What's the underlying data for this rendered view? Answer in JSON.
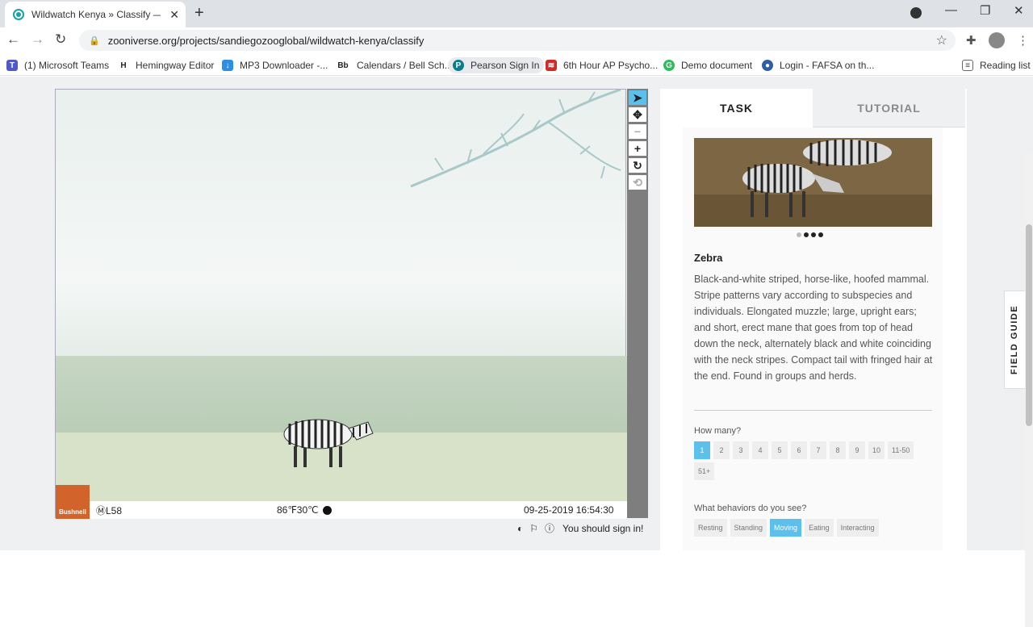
{
  "browser": {
    "tab_title": "Wildwatch Kenya » Classify — Zo",
    "url": "zooniverse.org/projects/sandiegozooglobal/wildwatch-kenya/classify",
    "bookmarks": [
      {
        "label": "(1) Microsoft Teams"
      },
      {
        "label": "Hemingway Editor"
      },
      {
        "label": "MP3 Downloader -..."
      },
      {
        "label": "Calendars / Bell Sch..."
      },
      {
        "label": "Pearson Sign In"
      },
      {
        "label": "6th Hour AP Psycho..."
      },
      {
        "label": "Demo document"
      },
      {
        "label": "Login - FAFSA on th..."
      }
    ],
    "reading_list": "Reading list",
    "icons": {
      "new_tab": "+",
      "close": "✕"
    }
  },
  "subject": {
    "camera_model": "ⓂL58",
    "temperature": "86℉30℃",
    "timestamp": "09-25-2019 16:54:30",
    "brand": "Bushnell"
  },
  "meta": {
    "sign_in": "You should sign in!"
  },
  "panel": {
    "tabs": [
      {
        "label": "TASK",
        "active": true
      },
      {
        "label": "TUTORIAL",
        "active": false
      }
    ],
    "species": {
      "name": "Zebra",
      "description": "Black-and-white striped, horse-like, hoofed mammal. Stripe patterns vary according to subspecies and individuals. Elongated muzzle; large, upright ears; and short, erect mane that goes from top of head down the neck, alternately black and white coinciding with the neck stripes. Compact tail with fringed hair at the end. Found in groups and herds."
    },
    "how_many": {
      "question": "How many?",
      "options": [
        "1",
        "2",
        "3",
        "4",
        "5",
        "6",
        "7",
        "8",
        "9",
        "10",
        "11-50",
        "51+"
      ],
      "selected": "1"
    },
    "behaviors": {
      "question": "What behaviors do you see?",
      "options": [
        "Resting",
        "Standing",
        "Moving",
        "Eating",
        "Interacting"
      ],
      "selected": "Moving"
    }
  },
  "field_guide": "FIELD GUIDE",
  "colors": {
    "accent": "#5bc0eb",
    "bushnell": "#d2642b"
  }
}
